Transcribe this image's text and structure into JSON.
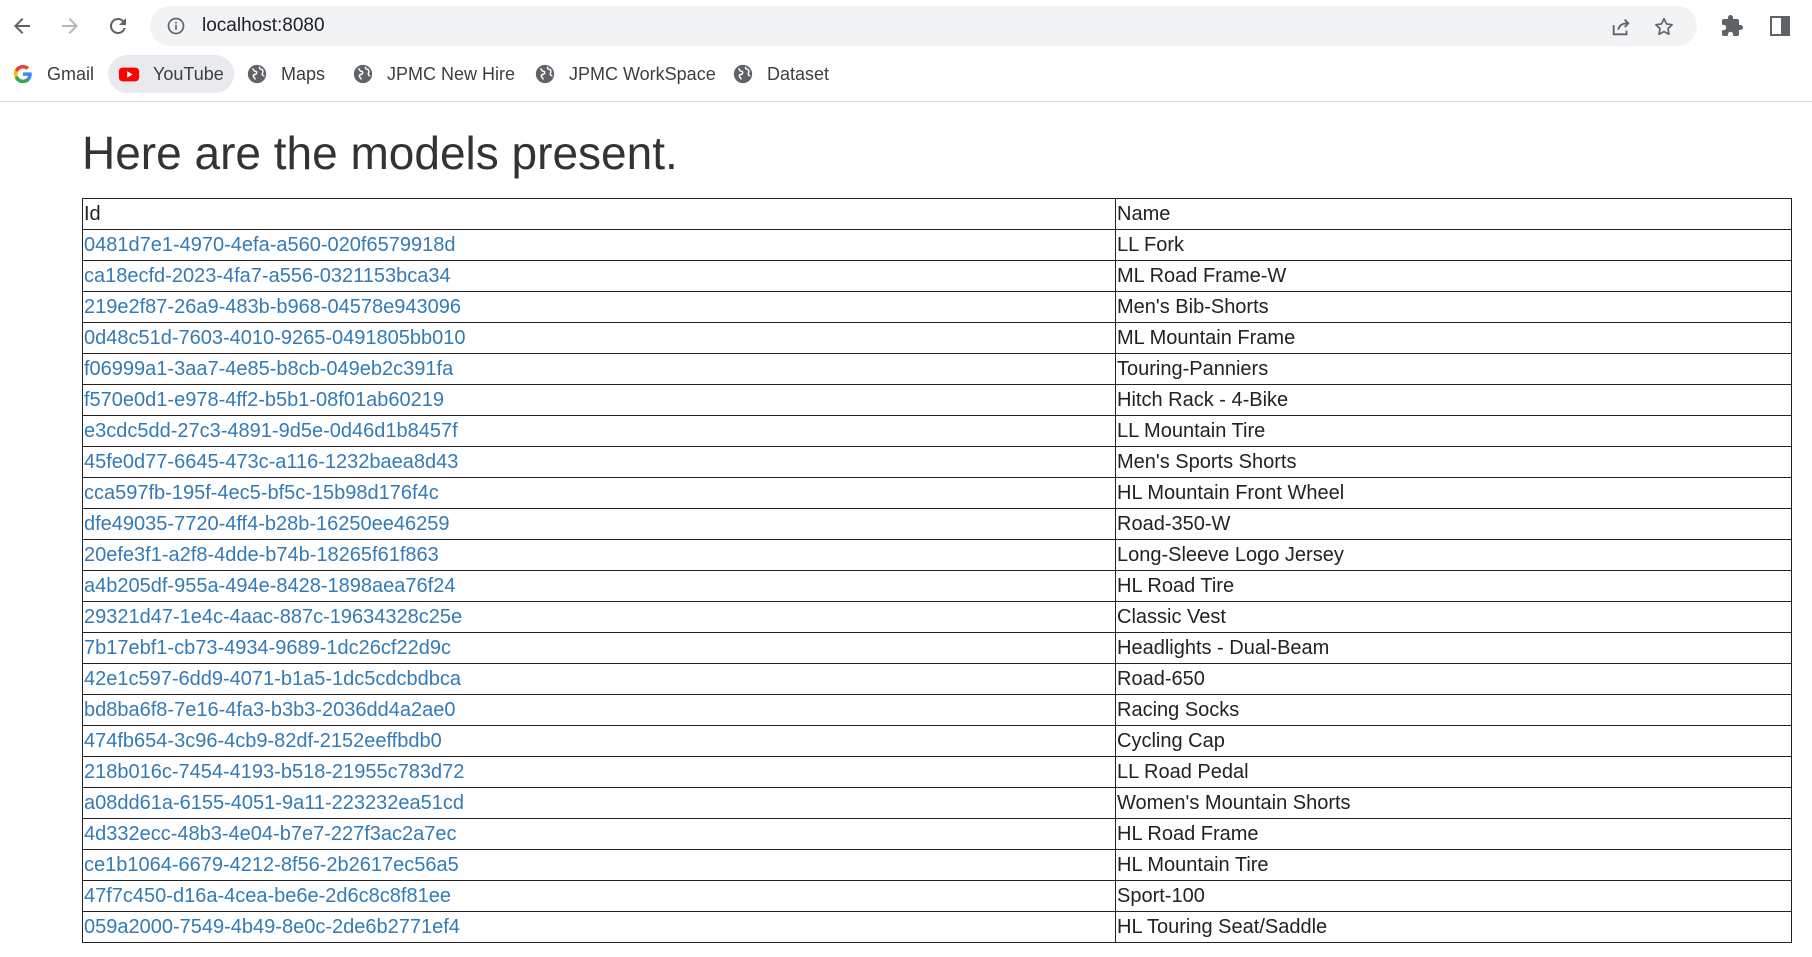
{
  "browser": {
    "url": "localhost:8080",
    "bookmarks": [
      {
        "label": "Gmail",
        "icon": "google-icon"
      },
      {
        "label": "YouTube",
        "icon": "youtube-icon"
      },
      {
        "label": "Maps",
        "icon": "globe-icon"
      },
      {
        "label": "JPMC New Hire",
        "icon": "globe-icon"
      },
      {
        "label": "JPMC WorkSpace",
        "icon": "globe-icon"
      },
      {
        "label": "Dataset",
        "icon": "globe-icon"
      }
    ]
  },
  "page": {
    "title": "Here are the models present.",
    "columns": {
      "id": "Id",
      "name": "Name"
    },
    "rows": [
      {
        "id": "0481d7e1-4970-4efa-a560-020f6579918d",
        "name": "LL Fork"
      },
      {
        "id": "ca18ecfd-2023-4fa7-a556-0321153bca34",
        "name": "ML Road Frame-W"
      },
      {
        "id": "219e2f87-26a9-483b-b968-04578e943096",
        "name": "Men's Bib-Shorts"
      },
      {
        "id": "0d48c51d-7603-4010-9265-0491805bb010",
        "name": "ML Mountain Frame"
      },
      {
        "id": "f06999a1-3aa7-4e85-b8cb-049eb2c391fa",
        "name": "Touring-Panniers"
      },
      {
        "id": "f570e0d1-e978-4ff2-b5b1-08f01ab60219",
        "name": "Hitch Rack - 4-Bike"
      },
      {
        "id": "e3cdc5dd-27c3-4891-9d5e-0d46d1b8457f",
        "name": "LL Mountain Tire"
      },
      {
        "id": "45fe0d77-6645-473c-a116-1232baea8d43",
        "name": "Men's Sports Shorts"
      },
      {
        "id": "cca597fb-195f-4ec5-bf5c-15b98d176f4c",
        "name": "HL Mountain Front Wheel"
      },
      {
        "id": "dfe49035-7720-4ff4-b28b-16250ee46259",
        "name": "Road-350-W"
      },
      {
        "id": "20efe3f1-a2f8-4dde-b74b-18265f61f863",
        "name": "Long-Sleeve Logo Jersey"
      },
      {
        "id": "a4b205df-955a-494e-8428-1898aea76f24",
        "name": "HL Road Tire"
      },
      {
        "id": "29321d47-1e4c-4aac-887c-19634328c25e",
        "name": "Classic Vest"
      },
      {
        "id": "7b17ebf1-cb73-4934-9689-1dc26cf22d9c",
        "name": "Headlights - Dual-Beam"
      },
      {
        "id": "42e1c597-6dd9-4071-b1a5-1dc5cdcbdbca",
        "name": "Road-650"
      },
      {
        "id": "bd8ba6f8-7e16-4fa3-b3b3-2036dd4a2ae0",
        "name": "Racing Socks"
      },
      {
        "id": "474fb654-3c96-4cb9-82df-2152eeffbdb0",
        "name": "Cycling Cap"
      },
      {
        "id": "218b016c-7454-4193-b518-21955c783d72",
        "name": "LL Road Pedal"
      },
      {
        "id": "a08dd61a-6155-4051-9a11-223232ea51cd",
        "name": "Women's Mountain Shorts"
      },
      {
        "id": "4d332ecc-48b3-4e04-b7e7-227f3ac2a7ec",
        "name": "HL Road Frame"
      },
      {
        "id": "ce1b1064-6679-4212-8f56-2b2617ec56a5",
        "name": "HL Mountain Tire"
      },
      {
        "id": "47f7c450-d16a-4cea-be6e-2d6c8c8f81ee",
        "name": "Sport-100"
      },
      {
        "id": "059a2000-7549-4b49-8e0c-2de6b2771ef4",
        "name": "HL Touring Seat/Saddle"
      }
    ]
  },
  "colors": {
    "link": "#337ab7",
    "text": "#222222",
    "title": "#333333",
    "omnibox_bg": "#f1f3f4",
    "youtube_red": "#ff0000"
  }
}
